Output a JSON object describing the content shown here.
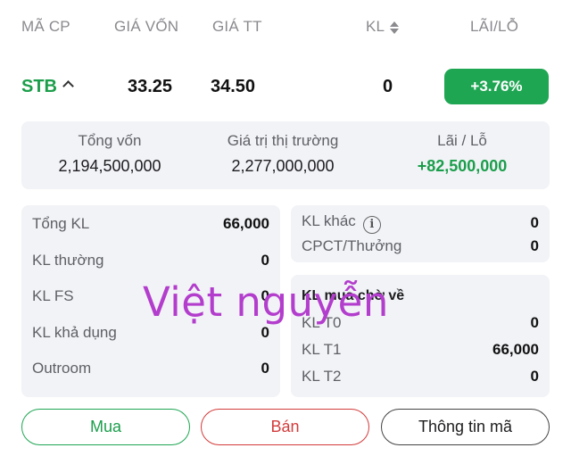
{
  "header": {
    "col_code": "MÃ CP",
    "col_cost": "GIÁ VỐN",
    "col_market": "GIÁ TT",
    "col_qty": "KL",
    "col_pl": "LÃI/LỖ"
  },
  "position": {
    "ticker": "STB",
    "cost_price": "33.25",
    "market_price": "34.50",
    "qty": "0",
    "pl_percent": "+3.76%"
  },
  "summary": {
    "capital_label": "Tổng vốn",
    "capital_value": "2,194,500,000",
    "market_value_label": "Giá trị thị trường",
    "market_value": "2,277,000,000",
    "pl_label": "Lãi / Lỗ",
    "pl_value": "+82,500,000"
  },
  "left_card": {
    "total_label": "Tổng KL",
    "total_value": "66,000",
    "normal_label": "KL thường",
    "normal_value": "0",
    "fs_label": "KL FS",
    "fs_value": "0",
    "available_label": "KL khả dụng",
    "available_value": "0",
    "outroom_label": "Outroom",
    "outroom_value": "0"
  },
  "right_top_card": {
    "other_label": "KL khác",
    "other_value": "0",
    "dividend_label": "CPCT/Thưởng",
    "dividend_value": "0"
  },
  "right_bottom_card": {
    "title": "KL mua chờ về",
    "t0_label": "KL T0",
    "t0_value": "0",
    "t1_label": "KL T1",
    "t1_value": "66,000",
    "t2_label": "KL T2",
    "t2_value": "0"
  },
  "watermark": "Việt nguyễn",
  "actions": {
    "buy": "Mua",
    "sell": "Bán",
    "info": "Thông tin mã"
  },
  "colors": {
    "green": "#1fa653",
    "red": "#d33b3b"
  },
  "icons": [
    "chevron-up-icon",
    "sort-icon",
    "info-icon"
  ]
}
